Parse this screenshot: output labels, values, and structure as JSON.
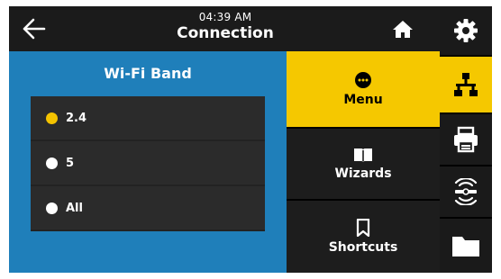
{
  "header": {
    "time": "04:39 AM",
    "title": "Connection",
    "back_icon": "arrow-left-icon",
    "home_icon": "home-icon"
  },
  "panel": {
    "title": "Wi-Fi Band",
    "options": [
      {
        "label": "2.4",
        "selected": true
      },
      {
        "label": "5",
        "selected": false
      },
      {
        "label": "All",
        "selected": false
      }
    ]
  },
  "menu": {
    "items": [
      {
        "label": "Menu",
        "icon": "dots-circle-icon",
        "active": true
      },
      {
        "label": "Wizards",
        "icon": "book-icon",
        "active": false
      },
      {
        "label": "Shortcuts",
        "icon": "bookmark-icon",
        "active": false
      }
    ]
  },
  "sidebar": {
    "items": [
      {
        "icon": "gear-icon",
        "active": false
      },
      {
        "icon": "network-icon",
        "active": true
      },
      {
        "icon": "printer-icon",
        "active": false
      },
      {
        "icon": "rfid-icon",
        "active": false
      },
      {
        "icon": "folder-icon",
        "active": false
      }
    ]
  },
  "colors": {
    "accent": "#f5c800",
    "panel_blue": "#1f7fba",
    "dark": "#1d1d1d"
  }
}
